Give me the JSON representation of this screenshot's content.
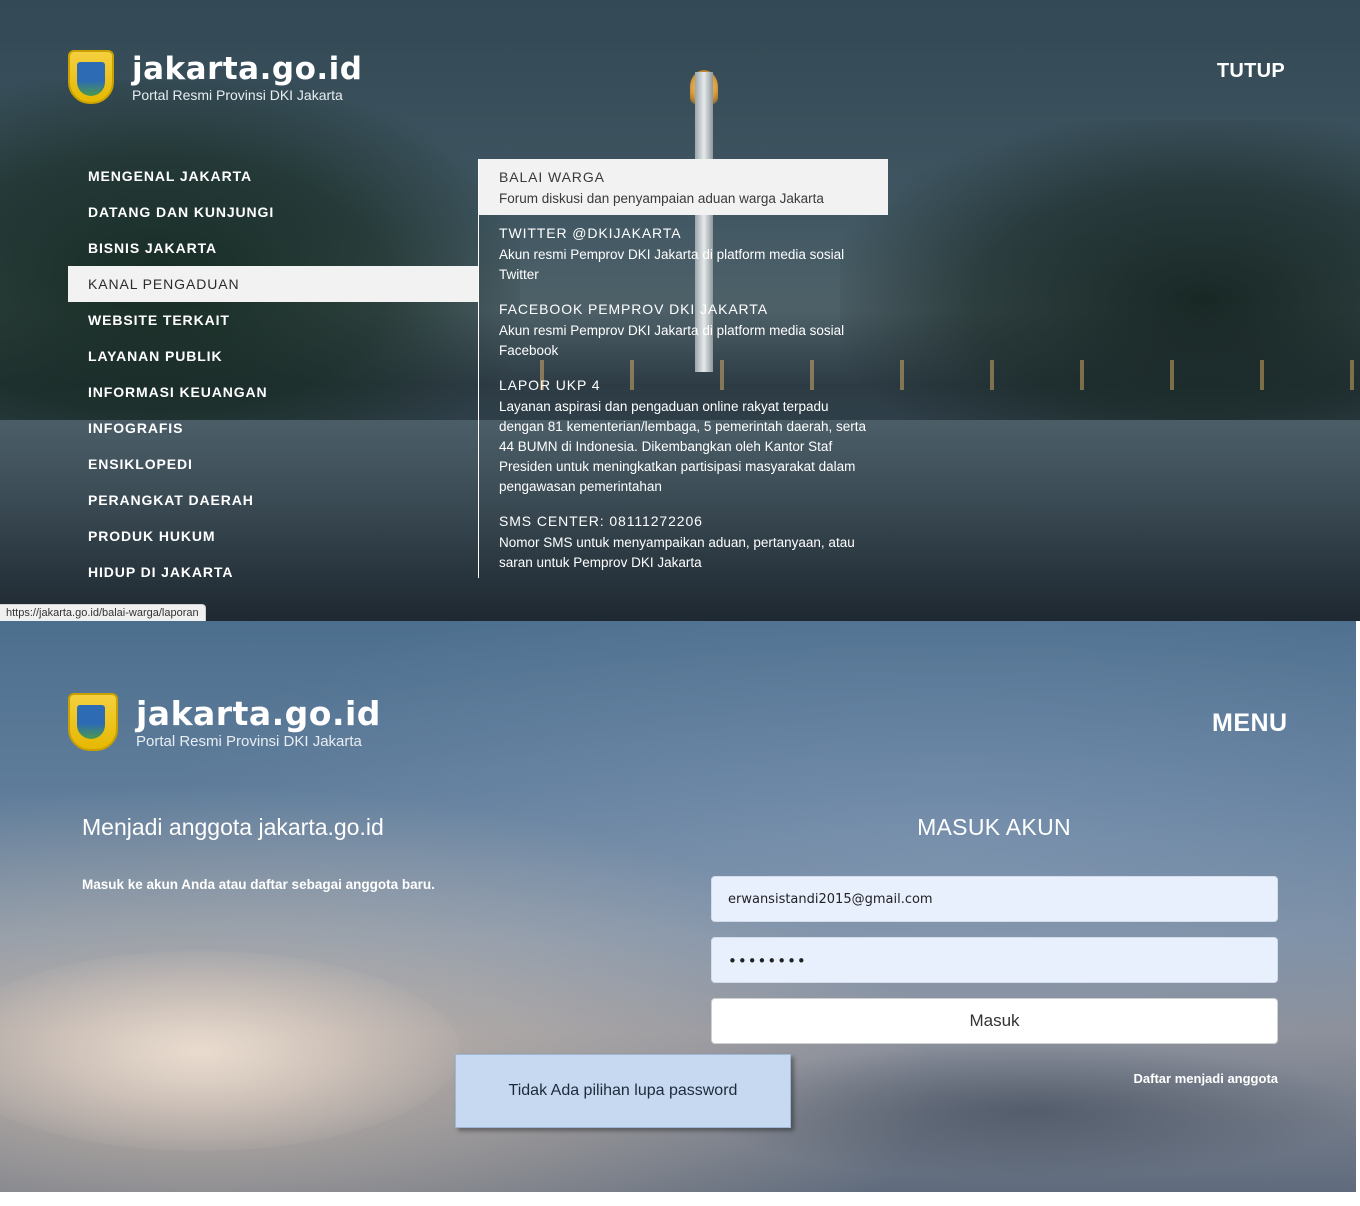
{
  "top": {
    "logo": {
      "title": "jakarta.go.id",
      "subtitle": "Portal Resmi Provinsi DKI Jakarta"
    },
    "close_label": "TUTUP",
    "menu_items": [
      "MENGENAL JAKARTA",
      "DATANG DAN KUNJUNGI",
      "BISNIS JAKARTA",
      "KANAL PENGADUAN",
      "WEBSITE TERKAIT",
      "LAYANAN PUBLIK",
      "INFORMASI KEUANGAN",
      "INFOGRAFIS",
      "ENSIKLOPEDI",
      "PERANGKAT DAERAH",
      "PRODUK HUKUM",
      "HIDUP DI JAKARTA"
    ],
    "active_menu_item": "KANAL PENGADUAN",
    "submenu": [
      {
        "name": "BALAI WARGA",
        "desc": "Forum diskusi dan penyampaian aduan warga Jakarta"
      },
      {
        "name": "TWITTER @DKIJAKARTA",
        "desc": "Akun resmi Pemprov DKI Jakarta di platform media sosial Twitter"
      },
      {
        "name": "FACEBOOK PEMPROV DKI JAKARTA",
        "desc": "Akun resmi Pemprov DKI Jakarta di platform media sosial Facebook"
      },
      {
        "name": "LAPOR UKP 4",
        "desc": "Layanan aspirasi dan pengaduan online rakyat terpadu dengan 81 kementerian/lembaga, 5 pemerintah daerah, serta 44 BUMN di Indonesia. Dikembangkan oleh Kantor Staf Presiden untuk meningkatkan partisipasi masyarakat dalam pengawasan pemerintahan"
      },
      {
        "name": "SMS CENTER: 08111272206",
        "desc": "Nomor SMS untuk menyampaikan aduan, pertanyaan, atau saran untuk Pemprov DKI Jakarta"
      }
    ],
    "status_url": "https://jakarta.go.id/balai-warga/laporan"
  },
  "bottom": {
    "logo": {
      "title": "jakarta.go.id",
      "subtitle": "Portal Resmi Provinsi DKI Jakarta"
    },
    "menu_label": "MENU",
    "join_title": "Menjadi anggota jakarta.go.id",
    "join_text": "Masuk ke akun Anda atau daftar sebagai anggota baru.",
    "login_title": "MASUK AKUN",
    "email_value": "erwansistandi2015@gmail.com",
    "password_mask": "••••••••",
    "submit_label": "Masuk",
    "register_link": "Daftar menjadi anggota",
    "note": "Tidak Ada pilihan lupa password"
  },
  "colors": {
    "highlight_bg": "#f2f2f2",
    "input_bg": "#e8f0fe",
    "note_bg": "#c6d9f1"
  }
}
